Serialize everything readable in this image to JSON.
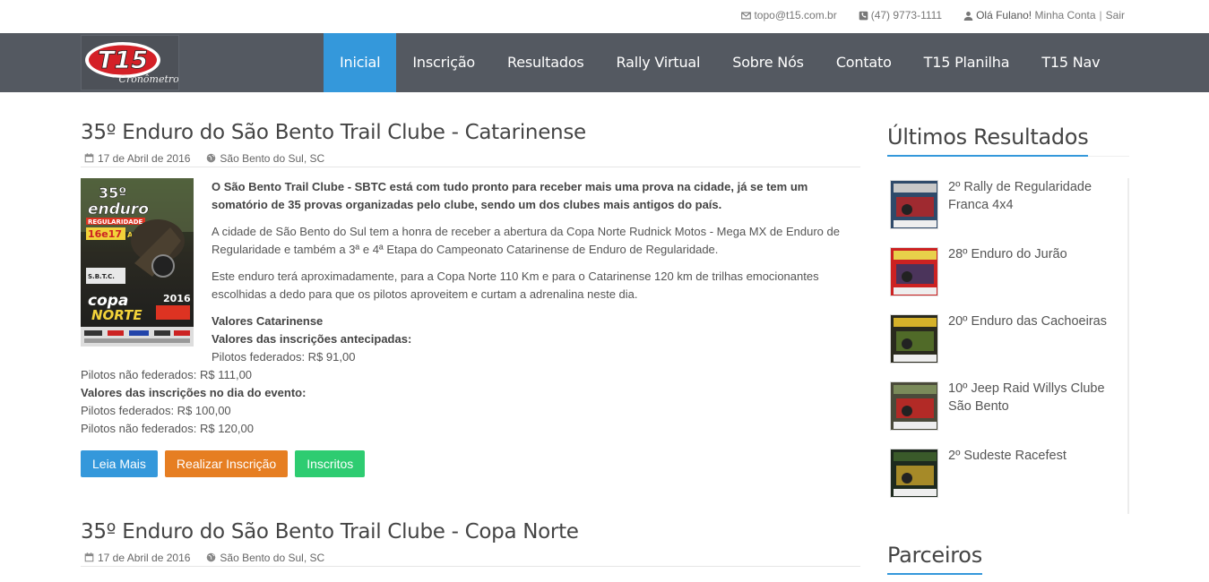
{
  "topbar": {
    "email": "topo@t15.com.br",
    "phone": "(47) 9773-1111",
    "greeting": "Olá Fulano!",
    "account_link": "Minha Conta",
    "separator": "|",
    "logout_link": "Sair"
  },
  "logo": {
    "text": "T15",
    "tagline": "Cronômetros"
  },
  "nav": {
    "items": [
      {
        "label": "Inicial",
        "active": true
      },
      {
        "label": "Inscrição"
      },
      {
        "label": "Resultados"
      },
      {
        "label": "Rally Virtual"
      },
      {
        "label": "Sobre Nós"
      },
      {
        "label": "Contato"
      },
      {
        "label": "T15 Planilha"
      },
      {
        "label": "T15 Nav"
      }
    ]
  },
  "posts": [
    {
      "title": "35º Enduro do São Bento Trail Clube - Catarinense",
      "date": "17 de Abril de 2016",
      "location": "São Bento do Sul, SC",
      "lead": "O São Bento Trail Clube - SBTC está com tudo pronto para receber mais uma prova na cidade, já se tem um somatório de 35 provas organizadas pelo clube, sendo um dos clubes mais antigos do país.",
      "paragraph1": "A cidade de São Bento do Sul tem a honra de receber a abertura da Copa Norte Rudnick Motos - Mega MX de Enduro de Regularidade e também a 3ª e 4ª Etapa do Campeonato Catarinense de Enduro de Regularidade.",
      "paragraph2": "Este enduro terá aproximadamente, para a Copa Norte 110 Km e para o Catarinense 120 km de trilhas emocionantes escolhidas a dedo para que os pilotos aproveitem e curtam a adrenalina neste dia.",
      "values_title": "Valores Catarinense",
      "early_title": "Valores das inscrições antecipadas:",
      "early_fed": "Pilotos federados: R$ 91,00",
      "early_nonfed": "Pilotos não federados: R$ 111,00",
      "day_title": "Valores das inscrições no dia do evento:",
      "day_fed": "Pilotos federados: R$ 100,00",
      "day_nonfed": "Pilotos não federados: R$ 120,00",
      "buttons": {
        "read_more": "Leia Mais",
        "register": "Realizar Inscrição",
        "registered": "Inscritos"
      },
      "poster_text": [
        "35º",
        "enduro",
        "REGULARIDADE",
        "16e17",
        "ABRIL",
        "S.B.T.C.",
        "copa",
        "NORTE",
        "2016"
      ]
    },
    {
      "title": "35º Enduro do São Bento Trail Clube - Copa Norte",
      "date": "17 de Abril de 2016",
      "location": "São Bento do Sul, SC"
    }
  ],
  "sidebar": {
    "results_title": "Últimos Resultados",
    "results": [
      {
        "title": "2º Rally de Regularidade Franca 4x4"
      },
      {
        "title": "28º Enduro do Jurão"
      },
      {
        "title": "20º Enduro das Cachoeiras"
      },
      {
        "title": "10º Jeep Raid Willys Clube São Bento"
      },
      {
        "title": "2º Sudeste Racefest"
      }
    ],
    "partners_title": "Parceiros"
  },
  "colors": {
    "nav_bg": "#545961",
    "accent_blue": "#3498db",
    "btn_orange": "#e67e22",
    "btn_green": "#2ecc71"
  },
  "icons": {
    "email": "envelope-icon",
    "phone": "phone-icon",
    "user": "user-icon",
    "date": "calendar-icon",
    "location": "globe-icon"
  }
}
